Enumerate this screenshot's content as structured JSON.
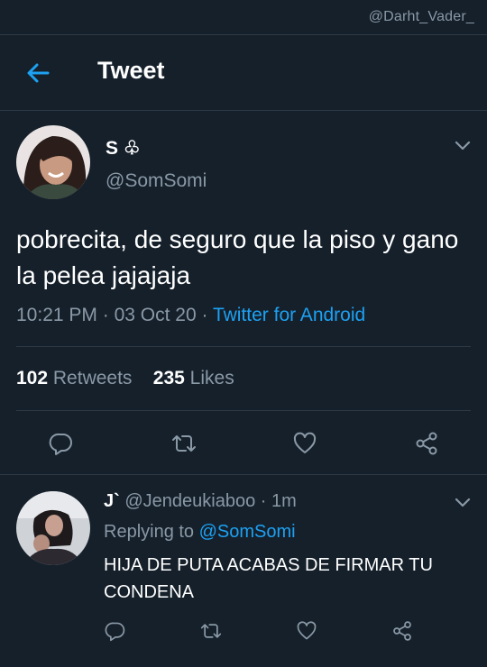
{
  "watermark": "@Darht_Vader_",
  "header": {
    "title": "Tweet",
    "back_icon": "arrow-left-icon",
    "accent": "#1da1f2"
  },
  "tweet": {
    "name": "S ♧",
    "handle": "@SomSomi",
    "text": "pobrecita, de seguro que la piso y gano la pelea jajajaja",
    "time": "10:21 PM",
    "date": "03 Oct 20",
    "source": "Twitter for Android",
    "retweets_count": "102",
    "retweets_label": "Retweets",
    "likes_count": "235",
    "likes_label": "Likes"
  },
  "reply": {
    "name": "J`",
    "handle": "@Jendeukiaboo",
    "time": "1m",
    "replying_label": "Replying to",
    "replying_to": "@SomSomi",
    "text": "HIJA DE PUTA ACABAS DE FIRMAR TU CONDENA"
  },
  "colors": {
    "background": "#15202b",
    "secondary_text": "#8a99a6",
    "divider": "#2c3a47",
    "link": "#1da1f2"
  }
}
